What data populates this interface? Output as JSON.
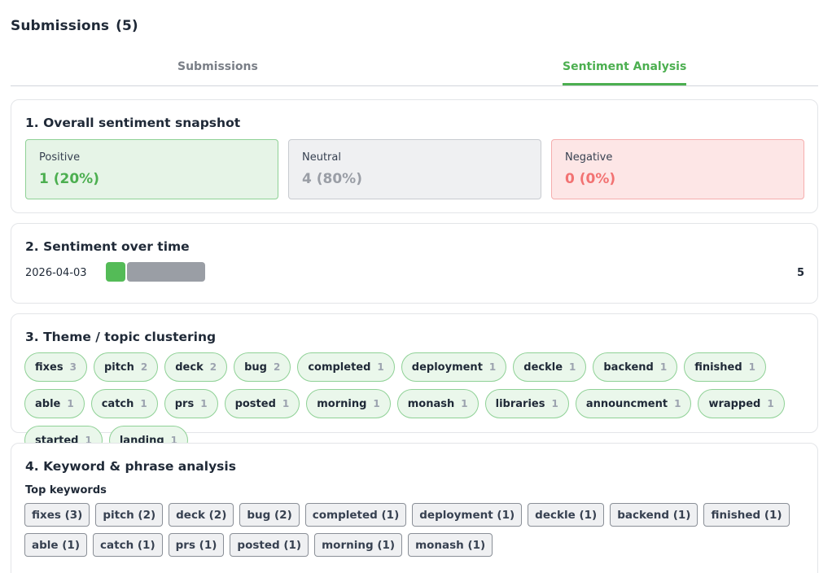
{
  "header": {
    "title": "Submissions",
    "count": "(5)"
  },
  "tabs": [
    {
      "label": "Submissions",
      "active": false
    },
    {
      "label": "Sentiment Analysis",
      "active": true
    }
  ],
  "snapshot": {
    "title": "1. Overall sentiment snapshot",
    "positive": {
      "label": "Positive",
      "value": "1 (20%)"
    },
    "neutral": {
      "label": "Neutral",
      "value": "4 (80%)"
    },
    "negative": {
      "label": "Negative",
      "value": "0 (0%)"
    }
  },
  "over_time": {
    "title": "2. Sentiment over time",
    "rows": [
      {
        "date": "2026-04-03",
        "positive": 1,
        "neutral": 4,
        "negative": 0,
        "total": "5"
      }
    ]
  },
  "themes": {
    "title": "3. Theme / topic clustering",
    "items": [
      {
        "label": "fixes",
        "count": "3"
      },
      {
        "label": "pitch",
        "count": "2"
      },
      {
        "label": "deck",
        "count": "2"
      },
      {
        "label": "bug",
        "count": "2"
      },
      {
        "label": "completed",
        "count": "1"
      },
      {
        "label": "deployment",
        "count": "1"
      },
      {
        "label": "deckle",
        "count": "1"
      },
      {
        "label": "backend",
        "count": "1"
      },
      {
        "label": "finished",
        "count": "1"
      },
      {
        "label": "able",
        "count": "1"
      },
      {
        "label": "catch",
        "count": "1"
      },
      {
        "label": "prs",
        "count": "1"
      },
      {
        "label": "posted",
        "count": "1"
      },
      {
        "label": "morning",
        "count": "1"
      },
      {
        "label": "monash",
        "count": "1"
      },
      {
        "label": "libraries",
        "count": "1"
      },
      {
        "label": "announcment",
        "count": "1"
      },
      {
        "label": "wrapped",
        "count": "1"
      },
      {
        "label": "started",
        "count": "1"
      },
      {
        "label": "landing",
        "count": "1"
      }
    ]
  },
  "keywords": {
    "title": "4. Keyword & phrase analysis",
    "subtitle": "Top keywords",
    "items": [
      "fixes (3)",
      "pitch (2)",
      "deck (2)",
      "bug (2)",
      "completed (1)",
      "deployment (1)",
      "deckle (1)",
      "backend (1)",
      "finished (1)",
      "able (1)",
      "catch (1)",
      "prs (1)",
      "posted (1)",
      "morning (1)",
      "monash (1)"
    ]
  },
  "colors": {
    "accent": "#4caf50",
    "positive": "#54bb57",
    "neutral": "#9a9ea5",
    "negative": "#f27272"
  }
}
